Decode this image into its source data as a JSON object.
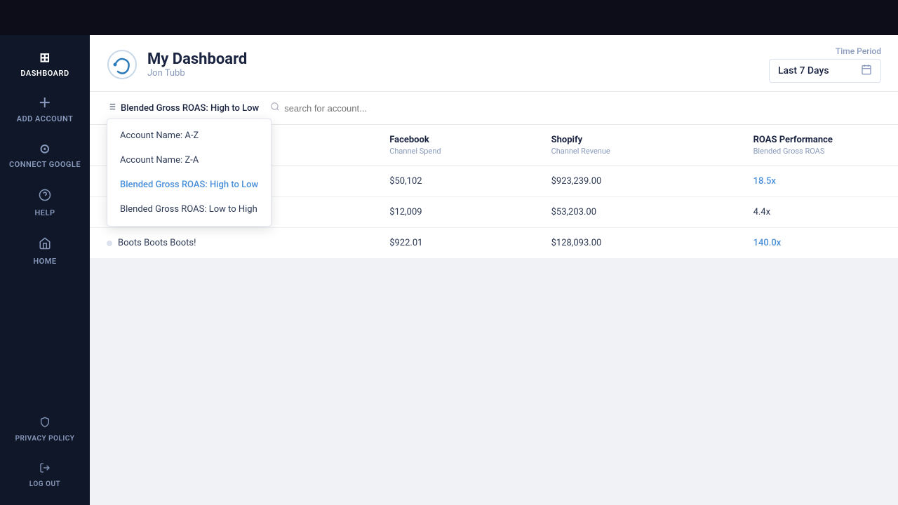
{
  "topBar": {},
  "sidebar": {
    "items": [
      {
        "id": "dashboard",
        "label": "DASHBOARD",
        "icon": "⊞",
        "active": true
      },
      {
        "id": "add-account",
        "label": "ADD ACCOUNT",
        "icon": "＋",
        "active": false
      },
      {
        "id": "connect-google",
        "label": "CONNECT GOOGLE",
        "icon": "⊙",
        "active": false
      },
      {
        "id": "help",
        "label": "HELP",
        "icon": "?",
        "active": false
      },
      {
        "id": "home",
        "label": "HOME",
        "icon": "⌂",
        "active": false
      }
    ],
    "bottomItems": [
      {
        "id": "privacy-policy",
        "label": "PRIVACY POLICY",
        "icon": "🔒"
      },
      {
        "id": "log-out",
        "label": "LOG OUT",
        "icon": "⏻"
      }
    ]
  },
  "header": {
    "title": "My Dashboard",
    "subtitle": "Jon Tubb",
    "timePeriodLabel": "Time Period",
    "timePeriodValue": "Last 7 Days"
  },
  "toolbar": {
    "sortLabel": "Blended Gross ROAS: High to Low",
    "searchPlaceholder": "search for account..."
  },
  "sortDropdown": {
    "visible": true,
    "options": [
      {
        "id": "account-az",
        "label": "Account Name: A-Z",
        "selected": false
      },
      {
        "id": "account-za",
        "label": "Account Name: Z-A",
        "selected": false
      },
      {
        "id": "roas-high-low",
        "label": "Blended Gross ROAS: High to Low",
        "selected": true
      },
      {
        "id": "roas-low-high",
        "label": "Blended Gross ROAS: Low to High",
        "selected": false
      }
    ]
  },
  "table": {
    "columns": [
      {
        "id": "account",
        "label": "",
        "sublabel": ""
      },
      {
        "id": "facebook",
        "label": "Facebook",
        "sublabel": "Channel Spend"
      },
      {
        "id": "shopify",
        "label": "Shopify",
        "sublabel": "Channel Revenue"
      },
      {
        "id": "roas",
        "label": "ROAS Performance",
        "sublabel": "Blended Gross ROAS"
      }
    ],
    "rows": [
      {
        "name": "",
        "facebook": "$50,102",
        "shopify": "$923,239.00",
        "roas": "18.5x",
        "roasHighlight": true
      },
      {
        "name": "",
        "facebook": "$12,009",
        "shopify": "$53,203.00",
        "roas": "4.4x",
        "roasHighlight": false
      },
      {
        "name": "Boots Boots Boots!",
        "facebook": "$922.01",
        "shopify": "$128,093.00",
        "roas": "140.0x",
        "roasHighlight": true
      }
    ]
  }
}
